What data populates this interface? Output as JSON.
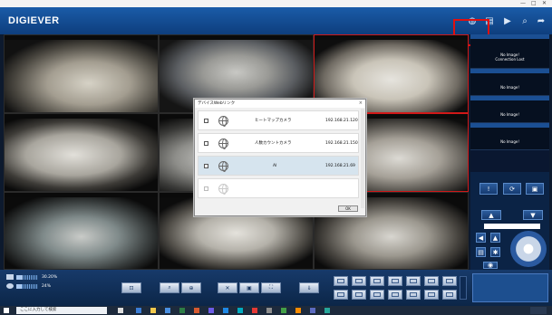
{
  "window": {
    "title": "",
    "controls": [
      "—",
      "□",
      "✕"
    ]
  },
  "header": {
    "logo": "DIGIEVER",
    "icons": [
      "globe-icon",
      "layout-icon",
      "playback-icon",
      "search-icon",
      "logout-icon"
    ],
    "icon_glyphs": [
      "◍",
      "▤",
      "▶",
      "⌕",
      "➦"
    ]
  },
  "grid": {
    "cells": [
      {
        "name": "",
        "res": "",
        "status": ""
      },
      {
        "name": "",
        "res": "",
        "status": ""
      },
      {
        "name": "",
        "res": "",
        "status": ""
      },
      {
        "name": "",
        "res": "",
        "status": ""
      },
      {
        "name": "",
        "res": "",
        "status": ""
      },
      {
        "name": "",
        "res": "",
        "status": ""
      },
      {
        "name": "",
        "res": "",
        "status": ""
      },
      {
        "name": "",
        "res": "",
        "status": ""
      },
      {
        "name": "",
        "res": "",
        "status": ""
      }
    ]
  },
  "right_panel": {
    "tiles": [
      {
        "name": "",
        "timestamp": "",
        "message": "No Image!\nConnection Lost"
      },
      {
        "name": "",
        "timestamp": "",
        "message": "No Image!"
      },
      {
        "name": "",
        "timestamp": "",
        "message": "No Image!"
      },
      {
        "name": "",
        "timestamp": "",
        "message": "No Image!"
      }
    ]
  },
  "dialog": {
    "title": "デバイスWebリンク",
    "close": "×",
    "rows": [
      {
        "name": "ヒートマップカメラ",
        "ip": "192.168.21.120"
      },
      {
        "name": "人数カウントカメラ",
        "ip": "192.168.21.150"
      },
      {
        "name": "AI",
        "ip": "192.168.21.69"
      },
      {
        "name": "",
        "ip": ""
      }
    ],
    "ok": "OK"
  },
  "bottom": {
    "stat1": "30.20%",
    "stat2": "24%",
    "stat3": "",
    "stat4": "",
    "level1": 0.3,
    "level2": 0.24
  },
  "taskbar": {
    "search_placeholder": "ここに入力して検索"
  },
  "colors": {
    "header": "#1a5ca8",
    "highlight": "#e01010",
    "selected_row": "#d6e4ee"
  }
}
